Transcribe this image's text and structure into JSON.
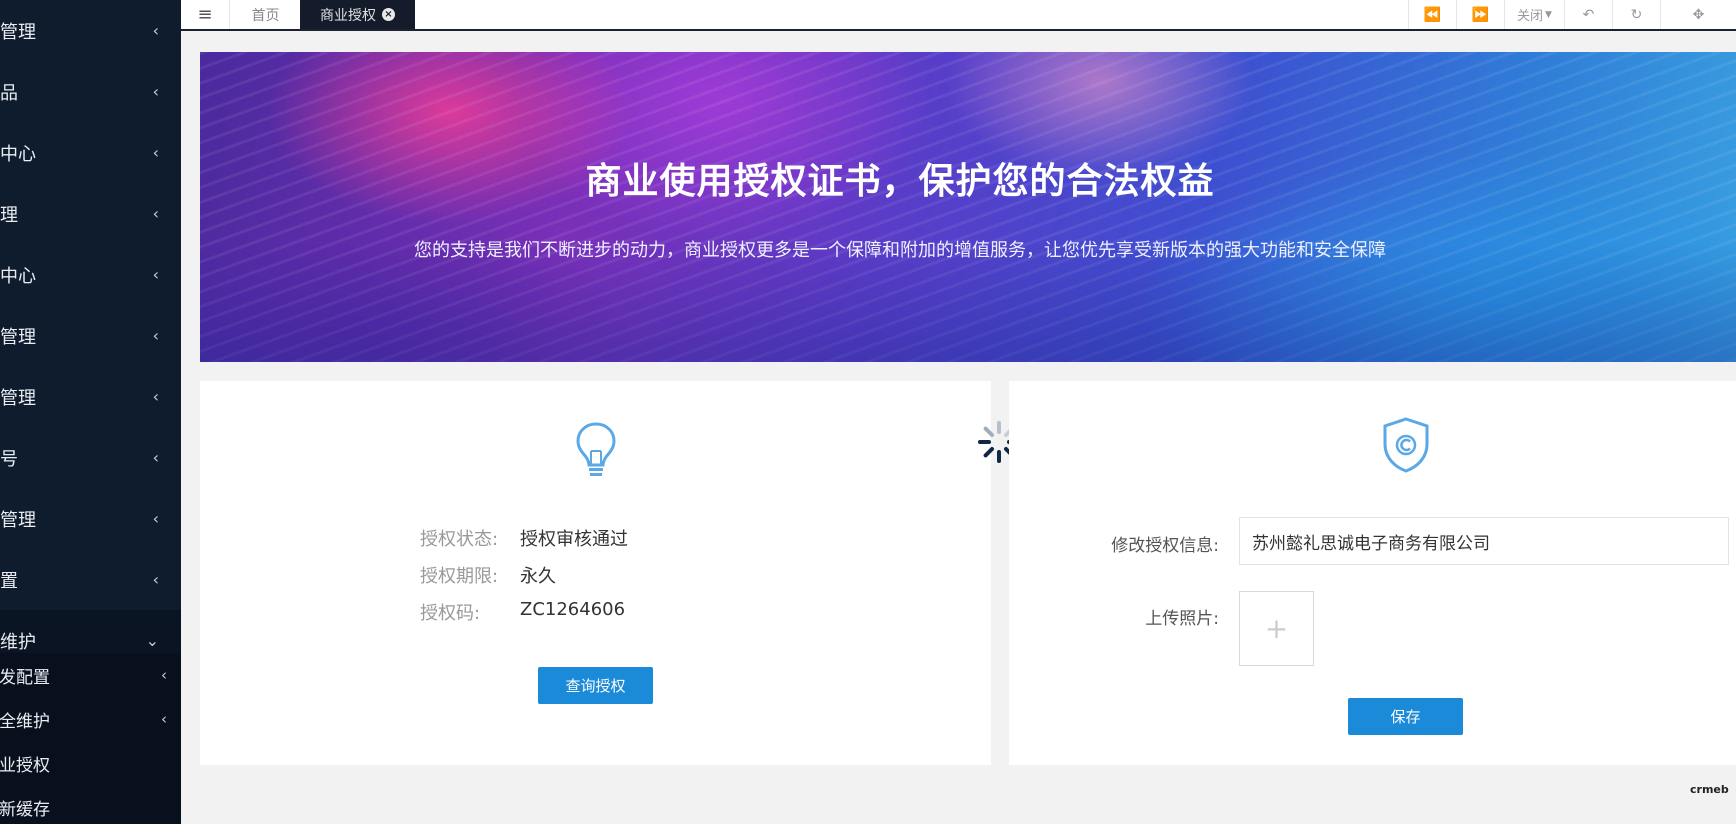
{
  "sidebar": {
    "items": [
      {
        "label": "收管理",
        "chevron": "‹"
      },
      {
        "label": "商品",
        "chevron": "‹"
      },
      {
        "label": "户中心",
        "chevron": "‹"
      },
      {
        "label": "管理",
        "chevron": "‹"
      },
      {
        "label": "销中心",
        "chevron": "‹"
      },
      {
        "label": "务管理",
        "chevron": "‹"
      },
      {
        "label": "容管理",
        "chevron": "‹"
      },
      {
        "label": "众号",
        "chevron": "‹"
      },
      {
        "label": "件管理",
        "chevron": "‹"
      },
      {
        "label": "设置",
        "chevron": "‹"
      },
      {
        "label": "统维护",
        "chevron": "⌄"
      }
    ],
    "subitems": [
      {
        "label": "开发配置",
        "chevron": "‹"
      },
      {
        "label": "安全维护",
        "chevron": "‹"
      },
      {
        "label": "商业授权",
        "chevron": ""
      },
      {
        "label": "刷新缓存",
        "chevron": ""
      }
    ]
  },
  "topbar": {
    "menu_icon": "≡",
    "tabs": [
      {
        "label": "首页"
      },
      {
        "label": "商业授权"
      }
    ],
    "close_label": "关闭"
  },
  "banner": {
    "title": "商业使用授权证书，保护您的合法权益",
    "subtitle": "您的支持是我们不断进步的动力，商业授权更多是一个保障和附加的增值服务，让您优先享受新版本的强大功能和安全保障"
  },
  "license": {
    "status_key": "授权状态:",
    "status_value": "授权审核通过",
    "period_key": "授权期限:",
    "period_value": "永久",
    "code_key": "授权码:",
    "code_value": "ZC1264606",
    "query_button": "查询授权"
  },
  "edit_form": {
    "info_label": "修改授权信息:",
    "info_value": "苏州懿礼思诚电子商务有限公司",
    "upload_label": "上传照片:",
    "upload_plus": "+",
    "save_button": "保存"
  },
  "footer": {
    "logo_text": "crmeb"
  },
  "colors": {
    "sidebar_bg": "#0f1c2e",
    "primary_button": "#1b8ad8",
    "icon_blue": "#5aa9e6"
  }
}
